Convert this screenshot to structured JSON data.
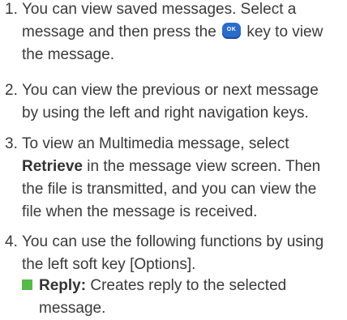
{
  "list": [
    {
      "num": "1.",
      "line1": "You can view saved messages. Select a",
      "line2_a": "message and then press the",
      "ok_label": "OK",
      "line2_b": "key to view",
      "line3": "the message."
    },
    {
      "num": "2.",
      "line1": "You can view the previous or next message",
      "line2": "by using the left and right navigation keys."
    },
    {
      "num": "3.",
      "line1": "To view an Multimedia message, select",
      "bold": "Retrieve",
      "line2_rest": "in the message view screen. Then",
      "line3": "the file is transmitted, and you can view the",
      "line4": "file when the message is received."
    },
    {
      "num": "4.",
      "line1": "You can use the following functions by using",
      "line2": "the left soft key [Options]."
    }
  ],
  "bullet": {
    "bold": "Reply:",
    "line1_rest": "Creates reply to the selected",
    "line2": "message.",
    "color": "#57b949"
  }
}
